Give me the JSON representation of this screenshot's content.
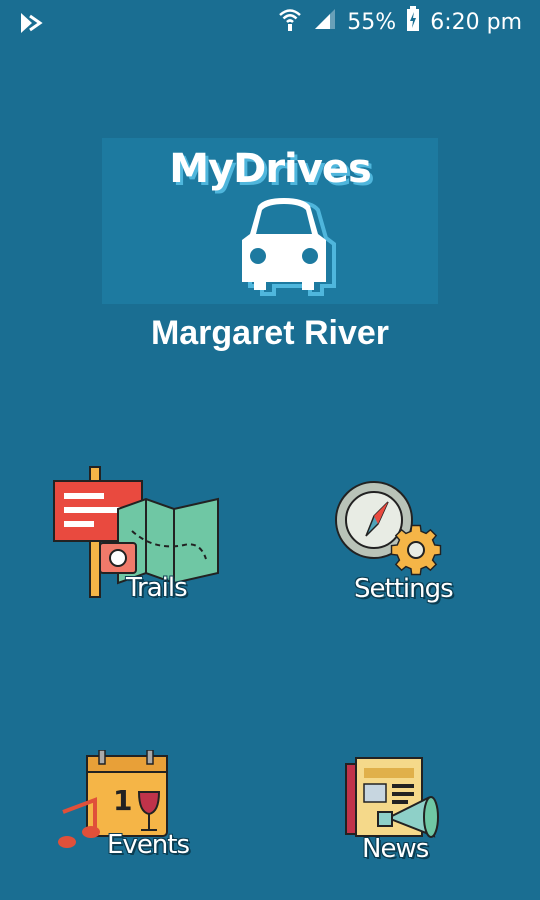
{
  "status_bar": {
    "battery_percent": "55%",
    "time": "6:20 pm",
    "icons": [
      "app-notification-icon",
      "wifi-icon",
      "signal-icon",
      "battery-charging-icon"
    ]
  },
  "logo": {
    "text": "MyDrives",
    "icon": "car-icon"
  },
  "region": {
    "title": "Margaret River"
  },
  "menu": {
    "trails": {
      "label": "Trails",
      "icon": "trails-map-icon"
    },
    "settings": {
      "label": "Settings",
      "icon": "compass-gear-icon"
    },
    "events": {
      "label": "Events",
      "icon": "calendar-wine-music-icon"
    },
    "news": {
      "label": "News",
      "icon": "newspaper-megaphone-icon"
    }
  },
  "colors": {
    "background": "#1a6e92",
    "logo_background": "#1d7aa0",
    "accent_shadow": "#4fb6dc"
  }
}
